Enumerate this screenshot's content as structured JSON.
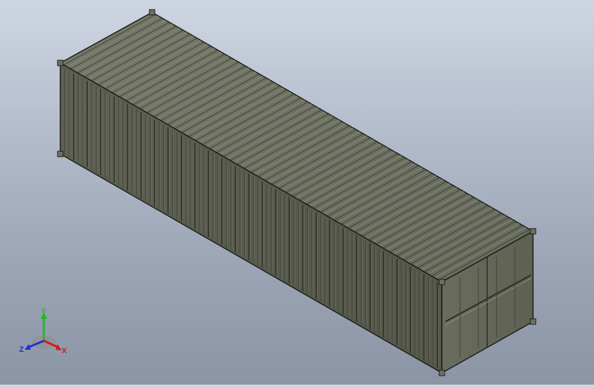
{
  "scene": {
    "model": "container",
    "background_top": "#cfd6e3",
    "background_bottom": "#8b95a6",
    "body_color": "#5f6253",
    "edge_color": "#1b1d17"
  },
  "triad": {
    "x_label": "X",
    "y_label": "Y",
    "z_label": "Z",
    "x_color": "#d01a1a",
    "y_color": "#2ab52a",
    "z_color": "#2030d0"
  }
}
